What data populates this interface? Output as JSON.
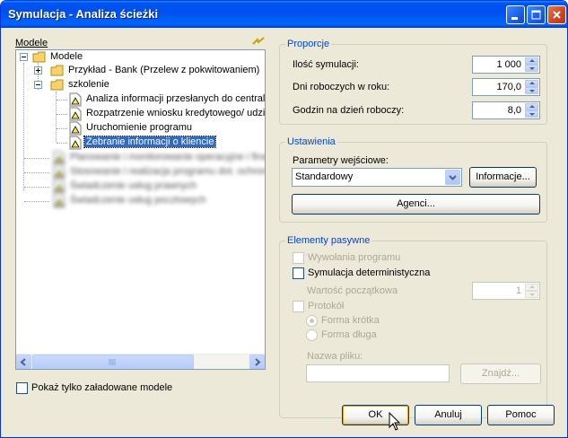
{
  "window": {
    "title": "Symulacja - Analiza ścieżki"
  },
  "tree": {
    "label": "Modele",
    "items": [
      {
        "label": "Modele"
      },
      {
        "label": "Przykład - Bank (Przelew z pokwitowaniem)"
      },
      {
        "label": "szkolenie"
      },
      {
        "label": "Analiza informacji przesłanych do centrali"
      },
      {
        "label": "Rozpatrzenie wniosku kredytowego/ udzi"
      },
      {
        "label": "Uruchomienie programu"
      },
      {
        "label": "Zebranie informacji o kliencie"
      },
      {
        "label": "Planowanie i monitorowanie operacyjne i finan"
      },
      {
        "label": "Stosowanie i realizacja programu dot. ochrony"
      },
      {
        "label": "Świadczenie usług prawnych"
      },
      {
        "label": "Świadczenie usług pocztowych"
      }
    ]
  },
  "show_loaded": {
    "label": "Pokaż tylko załadowane modele"
  },
  "proporcje": {
    "title": "Proporcje",
    "simulations_label": "Ilość symulacji:",
    "simulations_value": "1 000",
    "workdays_label": "Dni roboczych w roku:",
    "workdays_value": "170,0",
    "hours_label": "Godzin na dzień roboczy:",
    "hours_value": "8,0"
  },
  "ustawienia": {
    "title": "Ustawienia",
    "params_label": "Parametry wejściowe:",
    "params_value": "Standardowy",
    "info_button": "Informacje...",
    "agents_button": "Agenci..."
  },
  "pasywne": {
    "title": "Elementy pasywne",
    "calls_label": "Wywołania programu",
    "deterministic_label": "Symulacja deterministyczna",
    "initial_label": "Wartość początkowa",
    "initial_value": "1",
    "protocol_label": "Protokół",
    "short_label": "Forma krótka",
    "long_label": "Forma długa",
    "filename_label": "Nazwa pliku:",
    "find_button": "Znajdź..."
  },
  "buttons": {
    "ok": "OK",
    "cancel": "Anuluj",
    "help": "Pomoc"
  }
}
